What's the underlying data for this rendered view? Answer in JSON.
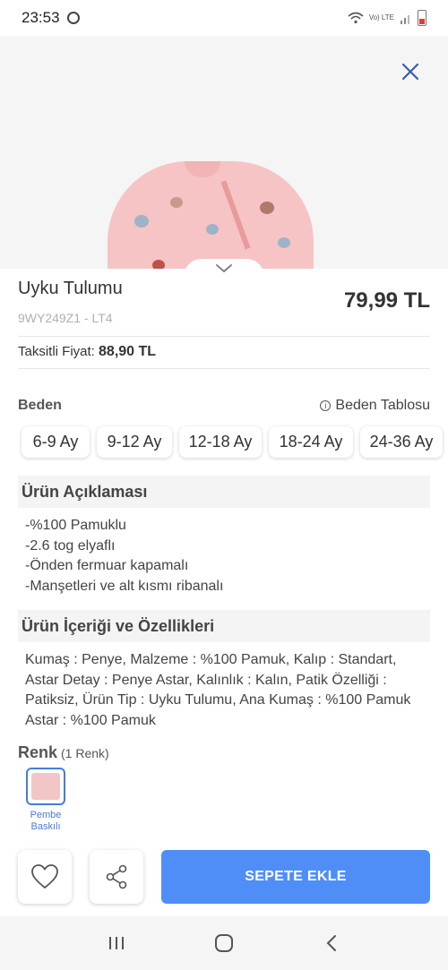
{
  "status_bar": {
    "time": "23:53",
    "network": "Vo) LTE"
  },
  "product": {
    "title": "Uyku Tulumu",
    "sku": "9WY249Z1 - LT4",
    "price": "79,99 TL",
    "installment_label": "Taksitli Fiyat:",
    "installment_price": "88,90 TL"
  },
  "size": {
    "label": "Beden",
    "table_label": "Beden Tablosu",
    "options": [
      "6-9 Ay",
      "9-12 Ay",
      "12-18 Ay",
      "18-24 Ay",
      "24-36 Ay"
    ]
  },
  "description": {
    "title": "Ürün Açıklaması",
    "lines": [
      "-%100 Pamuklu",
      "-2.6 tog elyaflı",
      "-Önden fermuar kapamalı",
      "-Manşetleri ve alt kısmı ribanalı"
    ]
  },
  "features": {
    "title": "Ürün İçeriği ve Özellikleri",
    "lines": [
      "Kumaş : Penye, Malzeme : %100 Pamuk, Kalıp : Standart,",
      "Astar Detay : Penye Astar, Kalınlık : Kalın, Patik Özelliği :",
      "Patiksiz, Ürün Tip : Uyku Tulumu, Ana Kumaş : %100 Pamuk",
      "Astar : %100 Pamuk"
    ]
  },
  "color": {
    "label": "Renk",
    "count": "(1 Renk)",
    "swatch_line1": "Pembe",
    "swatch_line2": "Baskılı",
    "swatch_hex": "#f2c6c6"
  },
  "actions": {
    "add_to_cart": "SEPETE EKLE"
  },
  "colors": {
    "accent": "#4f8ef7",
    "close": "#3b5bb5"
  }
}
